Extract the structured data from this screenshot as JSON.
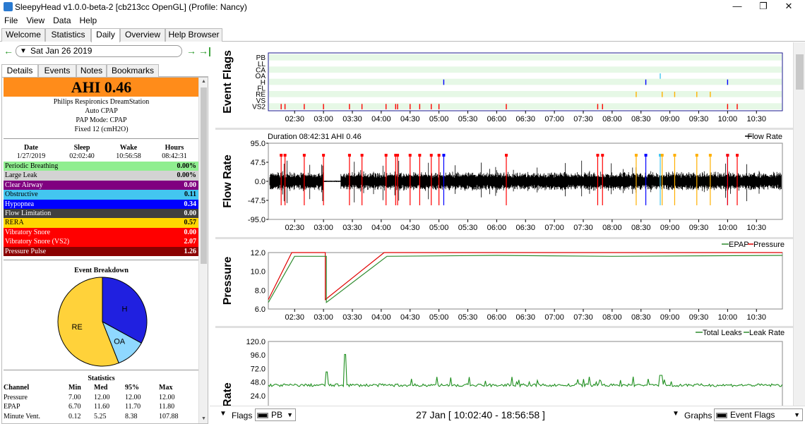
{
  "window": {
    "title": "SleepyHead v1.0.0-beta-2 [cb213cc OpenGL] (Profile: Nancy)",
    "minimize": "—",
    "maximize": "❐",
    "close": "✕"
  },
  "menu": [
    "File",
    "View",
    "Data",
    "Help"
  ],
  "tabs": [
    "Welcome",
    "Statistics",
    "Daily",
    "Overview",
    "Help Browser"
  ],
  "active_tab": "Daily",
  "date_nav": {
    "date": "Sat Jan 26 2019"
  },
  "subtabs": [
    "Details",
    "Events",
    "Notes",
    "Bookmarks"
  ],
  "summary": {
    "ahi": "AHI 0.46",
    "machine_lines": [
      "Philips Respironics DreamStation",
      "Auto CPAP",
      "PAP Mode: CPAP",
      "Fixed 12 (cmH2O)"
    ],
    "headers": [
      "Date",
      "Sleep",
      "Wake",
      "Hours"
    ],
    "values": [
      "1/27/2019",
      "02:02:40",
      "10:56:58",
      "08:42:31"
    ]
  },
  "indices": [
    {
      "label": "Periodic Breathing",
      "value": "0.00%",
      "color": "#90ee90",
      "text": "#000000"
    },
    {
      "label": "Large Leak",
      "value": "0.00%",
      "color": "#d3d3d3",
      "text": "#000000"
    },
    {
      "label": "Clear Airway",
      "value": "0.00",
      "color": "#800080",
      "text": "#ffffff"
    },
    {
      "label": "Obstructive",
      "value": "0.11",
      "color": "#43c6f0",
      "text": "#000000"
    },
    {
      "label": "Hypopnea",
      "value": "0.34",
      "color": "#0000ff",
      "text": "#ffffff"
    },
    {
      "label": "Flow Limitation",
      "value": "0.00",
      "color": "#404040",
      "text": "#ffffff"
    },
    {
      "label": "RERA",
      "value": "0.57",
      "color": "#ffd700",
      "text": "#000000"
    },
    {
      "label": "Vibratory Snore",
      "value": "0.00",
      "color": "#ff0000",
      "text": "#ffffff"
    },
    {
      "label": "Vibratory Snore (VS2)",
      "value": "2.07",
      "color": "#ff0000",
      "text": "#ffffff"
    },
    {
      "label": "Pressure Pulse",
      "value": "1.26",
      "color": "#8b0000",
      "text": "#ffffff"
    }
  ],
  "event_breakdown": {
    "title": "Event Breakdown",
    "slices": [
      {
        "label": "H",
        "fraction": 0.33,
        "color": "#2020e0"
      },
      {
        "label": "OA",
        "fraction": 0.11,
        "color": "#8fd8ff"
      },
      {
        "label": "RE",
        "fraction": 0.56,
        "color": "#ffd23a"
      }
    ]
  },
  "statistics": {
    "title": "Statistics",
    "headers": [
      "Channel",
      "Min",
      "Med",
      "95%",
      "Max"
    ],
    "rows": [
      [
        "Pressure",
        "7.00",
        "12.00",
        "12.00",
        "12.00"
      ],
      [
        "EPAP",
        "6.70",
        "11.60",
        "11.70",
        "11.80"
      ],
      [
        "Minute Vent.",
        "0.12",
        "5.25",
        "8.38",
        "107.88"
      ]
    ]
  },
  "time_ticks": [
    "02:30",
    "03:00",
    "03:30",
    "04:00",
    "04:30",
    "05:00",
    "05:30",
    "06:00",
    "06:30",
    "07:00",
    "07:30",
    "08:00",
    "08:30",
    "09:00",
    "09:30",
    "10:00",
    "10:30"
  ],
  "event_flags": {
    "title": "Event Flags",
    "rows": [
      "PB",
      "LL",
      "CA",
      "OA",
      "H",
      "FL",
      "RE",
      "VS",
      "VS2"
    ],
    "flags": [
      {
        "row": "OA",
        "time": "08:50",
        "color": "#43c6f0"
      },
      {
        "row": "H",
        "time": "05:05",
        "color": "#0000ff"
      },
      {
        "row": "H",
        "time": "08:35",
        "color": "#0000ff"
      },
      {
        "row": "H",
        "time": "10:00",
        "color": "#0000ff"
      },
      {
        "row": "RE",
        "time": "08:25",
        "color": "#ffb000"
      },
      {
        "row": "RE",
        "time": "08:52",
        "color": "#ffb000"
      },
      {
        "row": "RE",
        "time": "09:05",
        "color": "#ffb000"
      },
      {
        "row": "RE",
        "time": "09:28",
        "color": "#ffb000"
      },
      {
        "row": "RE",
        "time": "09:42",
        "color": "#ffb000"
      },
      {
        "row": "VS2",
        "time": "02:16",
        "color": "#ff0000"
      },
      {
        "row": "VS2",
        "time": "02:20",
        "color": "#ff0000"
      },
      {
        "row": "VS2",
        "time": "02:40",
        "color": "#ff0000"
      },
      {
        "row": "VS2",
        "time": "03:00",
        "color": "#ff0000"
      },
      {
        "row": "VS2",
        "time": "03:27",
        "color": "#ff0000"
      },
      {
        "row": "VS2",
        "time": "03:40",
        "color": "#ff0000"
      },
      {
        "row": "VS2",
        "time": "04:05",
        "color": "#ff0000"
      },
      {
        "row": "VS2",
        "time": "04:15",
        "color": "#ff0000"
      },
      {
        "row": "VS2",
        "time": "04:17",
        "color": "#ff0000"
      },
      {
        "row": "VS2",
        "time": "04:30",
        "color": "#ff0000"
      },
      {
        "row": "VS2",
        "time": "04:40",
        "color": "#ff0000"
      },
      {
        "row": "VS2",
        "time": "04:52",
        "color": "#ff0000"
      },
      {
        "row": "VS2",
        "time": "05:00",
        "color": "#ff0000"
      },
      {
        "row": "VS2",
        "time": "06:10",
        "color": "#ff0000"
      },
      {
        "row": "VS2",
        "time": "07:45",
        "color": "#ff0000"
      },
      {
        "row": "VS2",
        "time": "07:50",
        "color": "#ff0000"
      },
      {
        "row": "VS2",
        "time": "10:00",
        "color": "#ff0000"
      },
      {
        "row": "VS2",
        "time": "10:10",
        "color": "#ff0000"
      }
    ]
  },
  "flow_rate": {
    "title": "Flow Rate",
    "info": "Duration 08:42:31 AHI 0.46",
    "legend": "Flow Rate",
    "yticks": [
      "95.0",
      "47.5",
      "0.0",
      "-47.5",
      "-95.0"
    ]
  },
  "pressure": {
    "title": "Pressure",
    "legend": [
      "EPAP",
      "Pressure"
    ],
    "yticks": [
      "12.0",
      "10.0",
      "8.0",
      "6.0"
    ],
    "colors": {
      "epap": "#2e8b2e",
      "pressure": "#e00000"
    }
  },
  "leak_rate": {
    "title": "Leak Rate",
    "legend": [
      "Total Leaks",
      "Leak Rate"
    ],
    "yticks": [
      "120.0",
      "96.0",
      "72.0",
      "48.0",
      "24.0"
    ]
  },
  "bottombar": {
    "flags_label": "Flags",
    "flags_value": "PB",
    "date_range": "27 Jan [ 10:02:40 - 18:56:58 ]",
    "graphs_label": "Graphs",
    "graphs_value": "Event Flags"
  }
}
